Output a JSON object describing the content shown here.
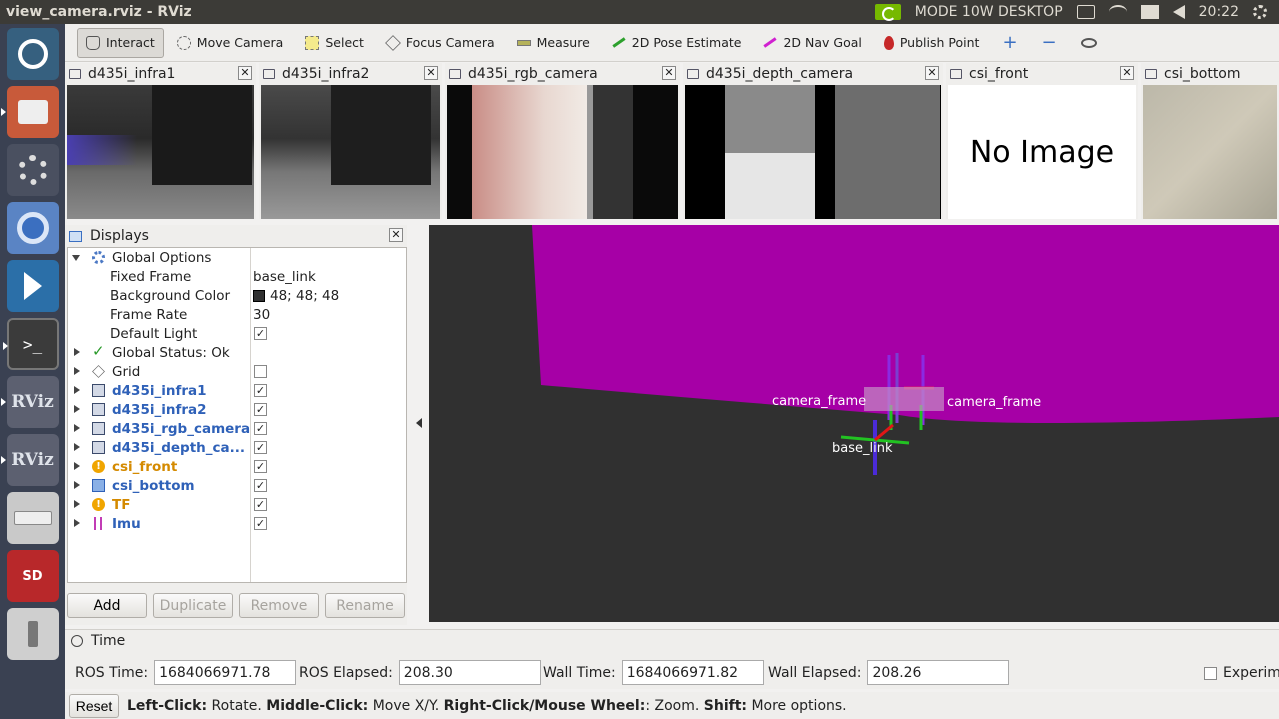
{
  "window": {
    "title": "view_camera.rviz - RViz"
  },
  "system_tray": {
    "mode": "MODE 10W DESKTOP",
    "clock": "20:22"
  },
  "launcher": {
    "items": [
      {
        "name": "ubuntu-launcher",
        "label": ""
      },
      {
        "name": "files",
        "label": ""
      },
      {
        "name": "system-settings",
        "label": ""
      },
      {
        "name": "chromium",
        "label": ""
      },
      {
        "name": "vscode",
        "label": ""
      },
      {
        "name": "terminal",
        "label": ">_"
      },
      {
        "name": "rviz-1",
        "label": "RViz"
      },
      {
        "name": "rviz-2",
        "label": "RViz"
      },
      {
        "name": "drive",
        "label": ""
      },
      {
        "name": "sd-card",
        "label": "SD"
      },
      {
        "name": "usb",
        "label": ""
      }
    ]
  },
  "toolbar": {
    "interact": "Interact",
    "move_camera": "Move Camera",
    "select": "Select",
    "focus_camera": "Focus Camera",
    "measure": "Measure",
    "pose_estimate": "2D Pose Estimate",
    "nav_goal": "2D Nav Goal",
    "publish_point": "Publish Point",
    "plus": "+",
    "minus": "−"
  },
  "cameras": [
    {
      "title": "d435i_infra1"
    },
    {
      "title": "d435i_infra2"
    },
    {
      "title": "d435i_rgb_camera"
    },
    {
      "title": "d435i_depth_camera"
    },
    {
      "title": "csi_front",
      "placeholder": "No Image"
    },
    {
      "title": "csi_bottom"
    }
  ],
  "displays": {
    "title": "Displays",
    "global_options": "Global Options",
    "fixed_frame": {
      "label": "Fixed Frame",
      "value": "base_link"
    },
    "background_color": {
      "label": "Background Color",
      "value": "48; 48; 48",
      "color": "#303030"
    },
    "frame_rate": {
      "label": "Frame Rate",
      "value": "30"
    },
    "default_light": {
      "label": "Default Light",
      "value": "✓"
    },
    "global_status": "Global Status: Ok",
    "items": [
      {
        "label": "Grid",
        "checked": ""
      },
      {
        "label": "d435i_infra1",
        "checked": "✓"
      },
      {
        "label": "d435i_infra2",
        "checked": "✓"
      },
      {
        "label": "d435i_rgb_camera",
        "checked": "✓"
      },
      {
        "label": "d435i_depth_ca...",
        "checked": "✓"
      },
      {
        "label": "csi_front",
        "checked": "✓"
      },
      {
        "label": "csi_bottom",
        "checked": "✓"
      },
      {
        "label": "TF",
        "checked": "✓"
      },
      {
        "label": "Imu",
        "checked": "✓"
      }
    ],
    "buttons": {
      "add": "Add",
      "duplicate": "Duplicate",
      "remove": "Remove",
      "rename": "Rename"
    }
  },
  "view3d": {
    "object_color": "#a600a6",
    "labels": {
      "camera_frames": "camera_frame",
      "base": "base_link"
    }
  },
  "time": {
    "title": "Time",
    "ros_time": {
      "label": "ROS Time:",
      "value": "1684066971.78"
    },
    "ros_elapsed": {
      "label": "ROS Elapsed:",
      "value": "208.30"
    },
    "wall_time": {
      "label": "Wall Time:",
      "value": "1684066971.82"
    },
    "wall_elapsed": {
      "label": "Wall Elapsed:",
      "value": "208.26"
    },
    "experimental": "Experim"
  },
  "status": {
    "reset": "Reset",
    "left_click_k": "Left-Click:",
    "left_click_v": "Rotate.",
    "middle_click_k": "Middle-Click:",
    "middle_click_v": "Move X/Y.",
    "right_click_k": "Right-Click/Mouse Wheel:",
    "right_click_v": ": Zoom.",
    "shift_k": "Shift:",
    "shift_v": "More options."
  }
}
